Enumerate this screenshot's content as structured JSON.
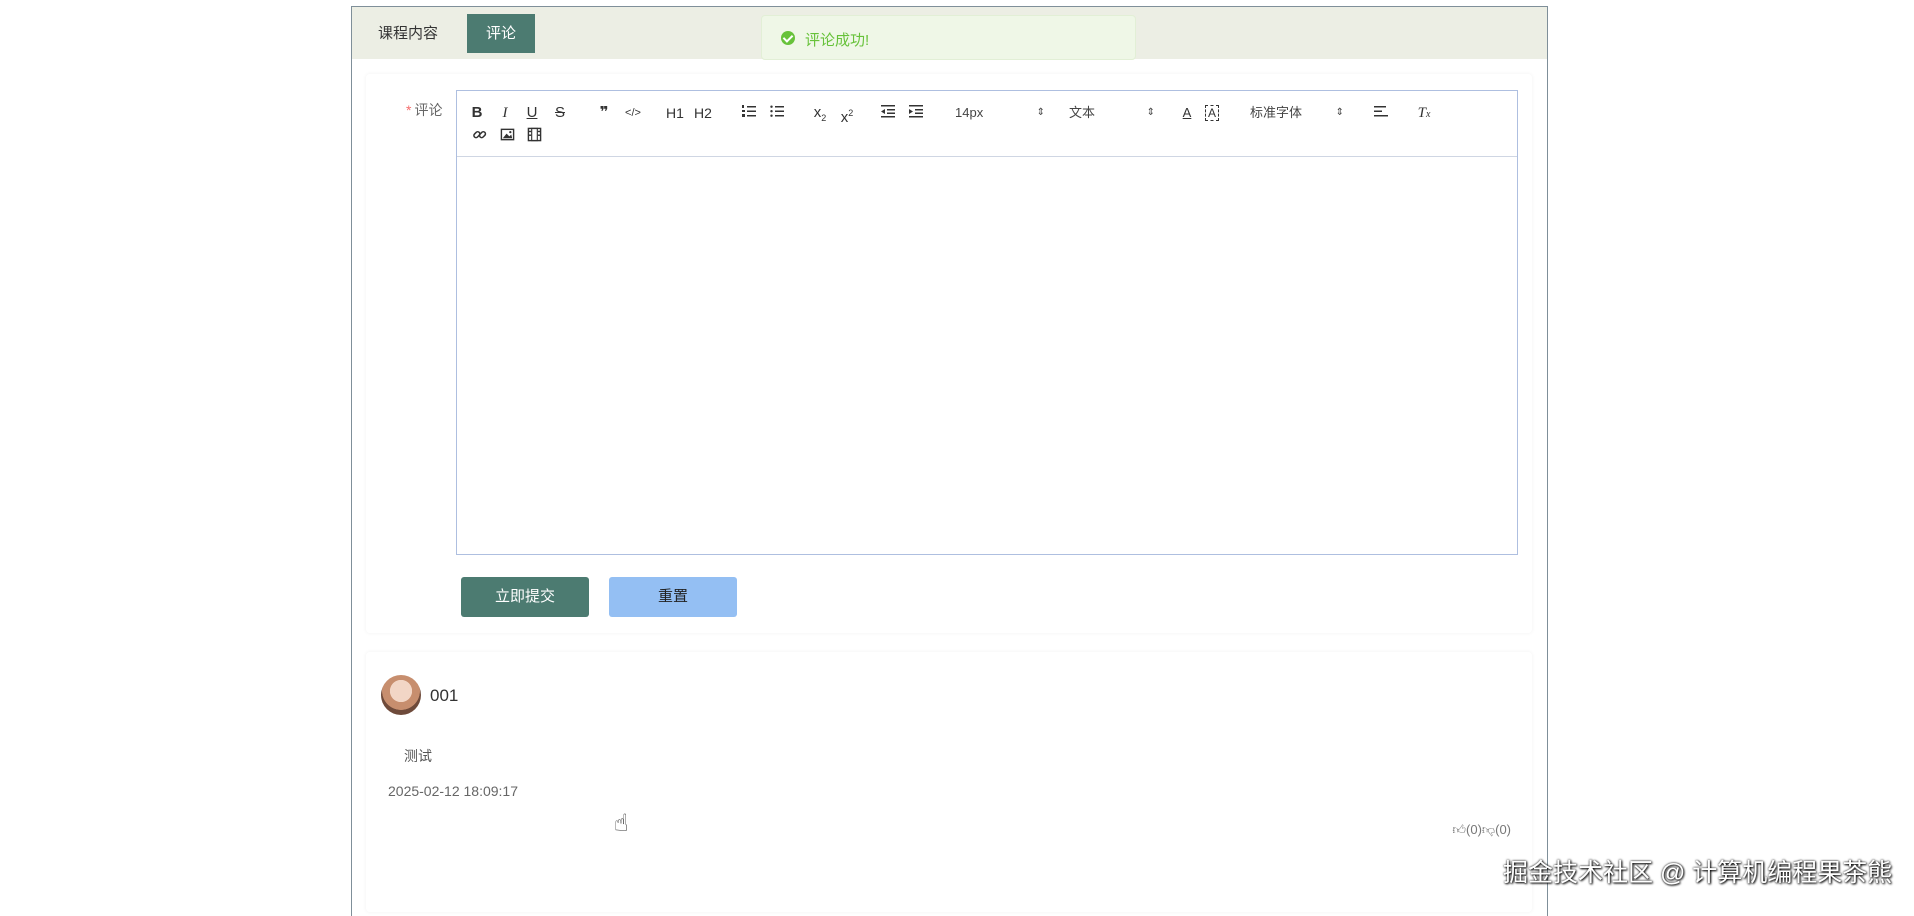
{
  "tabs": {
    "course": "课程内容",
    "comment": "评论"
  },
  "toast": {
    "message": "评论成功!",
    "icon": "check-circle-icon",
    "color": "#67c23a"
  },
  "form": {
    "label": "评论",
    "required_mark": "*",
    "toolbar": {
      "bold": "B",
      "italic": "I",
      "underline": "U",
      "strike": "S",
      "quote": "❞",
      "code": "</>",
      "h1": "H1",
      "h2": "H2",
      "font_size": "14px",
      "paragraph": "文本",
      "font_family": "标准字体"
    },
    "submit_label": "立即提交",
    "reset_label": "重置"
  },
  "comment": {
    "username": "001",
    "content": "测试",
    "time": "2025-02-12 18:09:17",
    "likes": "(0)",
    "dislikes": "(0)"
  },
  "watermark": "掘金技术社区 @ 计算机编程果茶熊",
  "colors": {
    "primary": "#4c7b71",
    "reset": "#94bff3",
    "tab_bar": "#eceee4"
  }
}
